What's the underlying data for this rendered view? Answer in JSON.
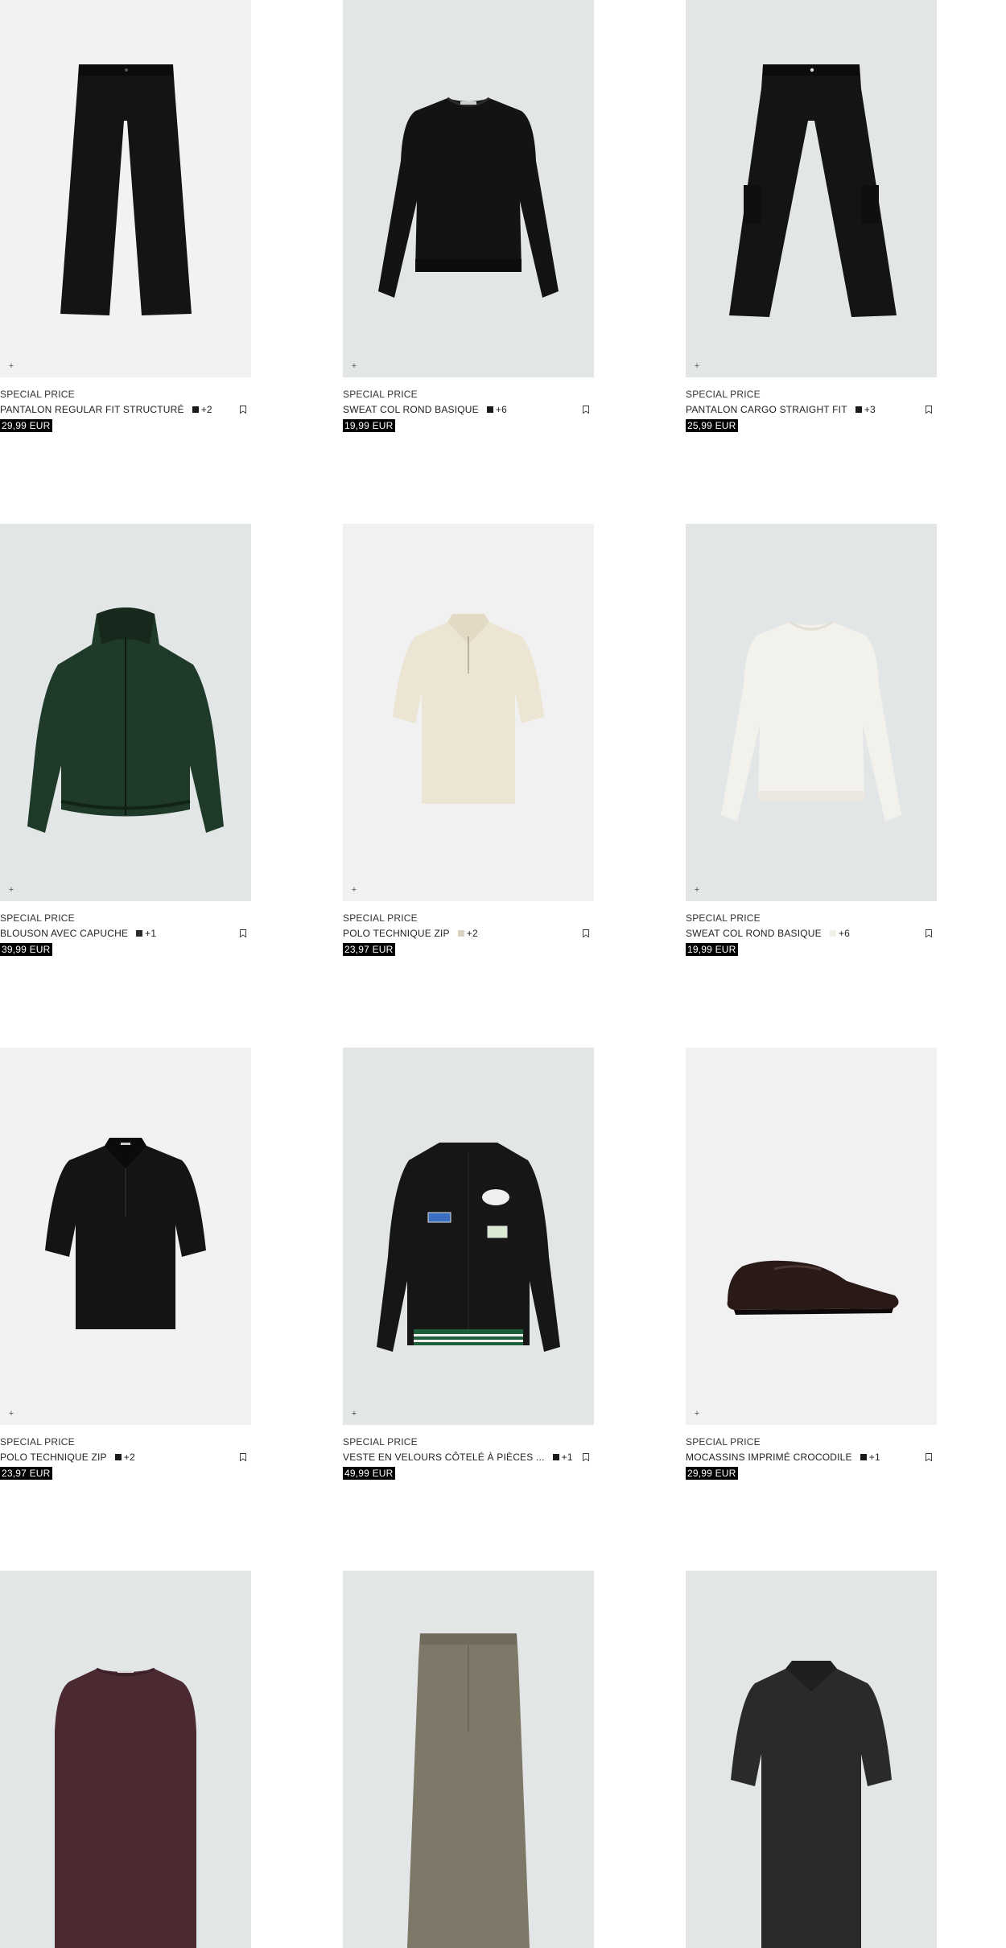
{
  "products": [
    {
      "tag": "SPECIAL PRICE",
      "name": "PANTALON REGULAR FIT STRUCTURÉ",
      "more": "+2",
      "price": "29,99 EUR",
      "swatch": "#1a1a1a",
      "bg": "#f1f2f2",
      "item": "trousers-black"
    },
    {
      "tag": "SPECIAL PRICE",
      "name": "SWEAT COL ROND BASIQUE",
      "more": "+6",
      "price": "19,99 EUR",
      "swatch": "#1a1a1a",
      "bg": "#e3e6e7",
      "item": "sweatshirt-black"
    },
    {
      "tag": "SPECIAL PRICE",
      "name": "PANTALON CARGO STRAIGHT FIT",
      "more": "+3",
      "price": "25,99 EUR",
      "swatch": "#1a1a1a",
      "bg": "#e3e6e7",
      "item": "cargo-black"
    },
    {
      "tag": "SPECIAL PRICE",
      "name": "BLOUSON AVEC CAPUCHE",
      "more": "+1",
      "price": "39,99 EUR",
      "swatch": "#2a2a2a",
      "bg": "#e3e6e7",
      "item": "jacket-green"
    },
    {
      "tag": "SPECIAL PRICE",
      "name": "POLO TECHNIQUE ZIP",
      "more": "+2",
      "price": "23,97 EUR",
      "swatch": "#d8d2c0",
      "bg": "#f1f1f1",
      "item": "polo-cream"
    },
    {
      "tag": "SPECIAL PRICE",
      "name": "SWEAT COL ROND BASIQUE",
      "more": "+6",
      "price": "19,99 EUR",
      "swatch": "#f3f1ec",
      "bg": "#e3e6e7",
      "item": "sweatshirt-white"
    },
    {
      "tag": "SPECIAL PRICE",
      "name": "POLO TECHNIQUE ZIP",
      "more": "+2",
      "price": "23,97 EUR",
      "swatch": "#1a1a1a",
      "bg": "#f1f2f2",
      "item": "polo-black"
    },
    {
      "tag": "SPECIAL PRICE",
      "name": "VESTE EN VELOURS CÔTELÉ À PIÈCES ...",
      "more": "+1",
      "price": "49,99 EUR",
      "swatch": "#1a1a1a",
      "bg": "#e3e6e7",
      "item": "varsity-black"
    },
    {
      "tag": "SPECIAL PRICE",
      "name": "MOCASSINS IMPRIMÉ CROCODILE",
      "more": "+1",
      "price": "29,99 EUR",
      "swatch": "#1a1a1a",
      "bg": "#f1f1f1",
      "item": "loafer-brown"
    },
    {
      "tag": "",
      "name": "",
      "more": "",
      "price": "",
      "swatch": "",
      "bg": "#e3e6e7",
      "item": "sweater-burgundy"
    },
    {
      "tag": "",
      "name": "",
      "more": "",
      "price": "",
      "swatch": "",
      "bg": "#e3e6e7",
      "item": "trousers-khaki"
    },
    {
      "tag": "",
      "name": "",
      "more": "",
      "price": "",
      "swatch": "",
      "bg": "#e3e6e7",
      "item": "polo-darkgrey"
    }
  ],
  "icons": {
    "quick_add": "plus-icon",
    "save": "bookmark-icon"
  }
}
